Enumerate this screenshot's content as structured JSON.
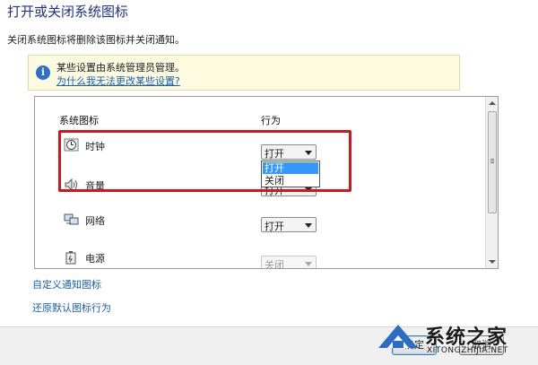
{
  "page": {
    "title": "打开或关闭系统图标",
    "description": "关闭系统图标将删除该图标并关闭通知。"
  },
  "info": {
    "text": "某些设置由系统管理员管理。",
    "link": "为什么我无法更改某些设置?"
  },
  "table": {
    "col_icon": "系统图标",
    "col_behavior": "行为",
    "rows": [
      {
        "icon": "clock-icon",
        "label": "时钟",
        "value": "打开",
        "disabled": false
      },
      {
        "icon": "volume-icon",
        "label": "音量",
        "value": "打开",
        "disabled": false
      },
      {
        "icon": "network-icon",
        "label": "网络",
        "value": "打开",
        "disabled": false
      },
      {
        "icon": "power-icon",
        "label": "电源",
        "value": "关闭",
        "disabled": true
      }
    ],
    "dropdown_options": [
      "打开",
      "关闭"
    ],
    "dropdown_selected": "打开"
  },
  "links": {
    "customize": "自定义通知图标",
    "restore": "还原默认图标行为"
  },
  "buttons": {
    "ok": "确定",
    "cancel": "取消"
  },
  "watermark": {
    "brand": "系统之家",
    "url": "XITONGZHIJIA.NET"
  },
  "colors": {
    "title": "#1e3287",
    "link": "#1a5fb4",
    "highlight_box": "#d0171a",
    "selection": "#3399ff"
  }
}
